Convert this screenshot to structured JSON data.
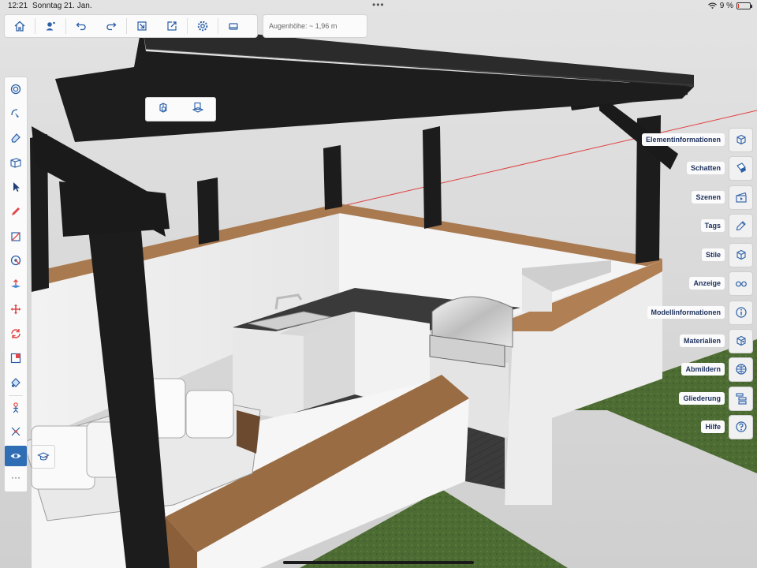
{
  "status": {
    "time": "12:21",
    "date": "Sonntag 21. Jan.",
    "battery": "9 %",
    "battery_level": 0.09
  },
  "top_toolbar": {
    "buttons": [
      "home-icon",
      "account-icon",
      "undo-icon",
      "redo-icon",
      "import-icon",
      "export-icon",
      "settings-icon",
      "xr-view-icon"
    ],
    "eye_height": "Augenhöhe: ~ 1,96 m"
  },
  "context_toolbar": {
    "buttons": [
      "make-component-icon",
      "paste-in-place-icon"
    ]
  },
  "left_tools": [
    "search-icon",
    "orbit-icon",
    "eraser-icon",
    "section-plane-icon",
    "select-icon",
    "pencil-icon",
    "rectangle-icon",
    "tape-measure-icon",
    "push-pull-icon",
    "move-icon",
    "rotate-icon",
    "scale-icon",
    "paint-bucket-icon",
    "walk-icon",
    "position-camera-icon",
    "look-around-icon"
  ],
  "right_panels": [
    {
      "label": "Elementinformationen",
      "icon": "entity-info-icon"
    },
    {
      "label": "Schatten",
      "icon": "shadows-icon"
    },
    {
      "label": "Szenen",
      "icon": "scenes-icon"
    },
    {
      "label": "Tags",
      "icon": "tags-icon"
    },
    {
      "label": "Stile",
      "icon": "styles-icon"
    },
    {
      "label": "Anzeige",
      "icon": "display-icon"
    },
    {
      "label": "Modellinformationen",
      "icon": "model-info-icon"
    },
    {
      "label": "Materialien",
      "icon": "materials-icon"
    },
    {
      "label": "Abmildern",
      "icon": "soften-icon"
    },
    {
      "label": "Gliederung",
      "icon": "outliner-icon"
    },
    {
      "label": "Hilfe",
      "icon": "help-icon"
    }
  ],
  "colors": {
    "accent": "#2f6db5",
    "label_text": "#1b2f5c",
    "beams": "#1c1c1c",
    "wood": "#a4754c",
    "grass": "#4a6a31"
  }
}
